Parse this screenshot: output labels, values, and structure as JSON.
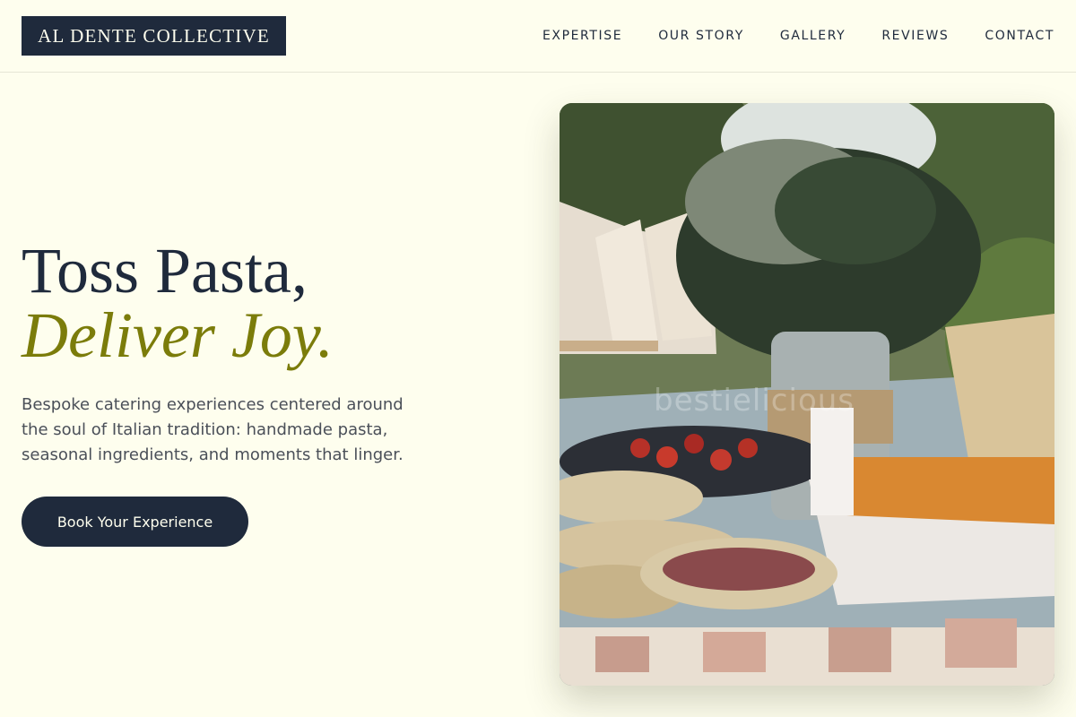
{
  "header": {
    "logo": "AL DENTE COLLECTIVE",
    "nav": [
      "EXPERTISE",
      "OUR STORY",
      "GALLERY",
      "REVIEWS",
      "CONTACT"
    ]
  },
  "hero": {
    "title_line1": "Toss Pasta,",
    "title_line2": "Deliver Joy.",
    "description": "Bespoke catering experiences centered around the soul of Italian tradition: handmade pasta, seasonal ingredients, and moments that linger.",
    "cta_label": "Book Your Experience"
  },
  "image": {
    "alt": "Outdoor catering table with floral centerpiece in a jar, platters of appetizers, charcuterie and tortilla chips",
    "watermark": "bestielicious"
  },
  "colors": {
    "background": "#fefeee",
    "primary": "#1f2a3c",
    "accent": "#7b7c0a",
    "text_muted": "#4a4f58"
  }
}
